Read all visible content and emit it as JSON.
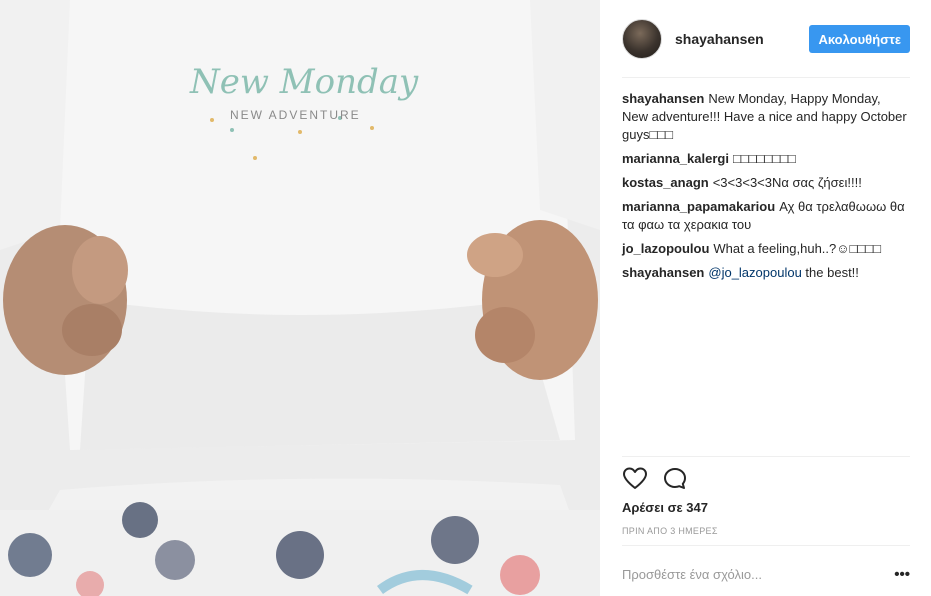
{
  "photo": {
    "shirt_title": "New Monday",
    "shirt_subtitle": "NEW ADVENTURE"
  },
  "post": {
    "username": "shayahansen",
    "follow_label": "Ακολουθήστε",
    "likes_text": "Αρέσει σε 347",
    "timestamp": "ΠΡΙΝ ΑΠΟ 3 ΗΜΕΡΕΣ",
    "comment_placeholder": "Προσθέστε ένα σχόλιο...",
    "more_label": "•••"
  },
  "comments": [
    {
      "author": "shayahansen",
      "text": "New Monday, Happy Monday, New adventure!!! Have a nice and happy October guys□□□"
    },
    {
      "author": "marianna_kalergi",
      "text": "□□□□□□□□"
    },
    {
      "author": "kostas_anagn",
      "text": "<3<3<3<3Να σας ζήσει!!!!"
    },
    {
      "author": "marianna_papamakariou",
      "text": "Αχ θα τρελαθωωω θα τα φαω τα χερακια του"
    },
    {
      "author": "jo_lazopoulou",
      "text": "What a feeling,huh..?☺□□□□"
    },
    {
      "author": "shayahansen",
      "mention": "@jo_lazopoulou",
      "text": " the best!!"
    }
  ],
  "icons": {
    "like": "heart-outline-icon",
    "comment": "speech-bubble-icon",
    "more": "ellipsis-icon"
  },
  "colors": {
    "follow_button": "#3897f0",
    "mention": "#003569",
    "shirt_print": "#8fc1b5",
    "shirt_dots": "#e2b96a"
  }
}
